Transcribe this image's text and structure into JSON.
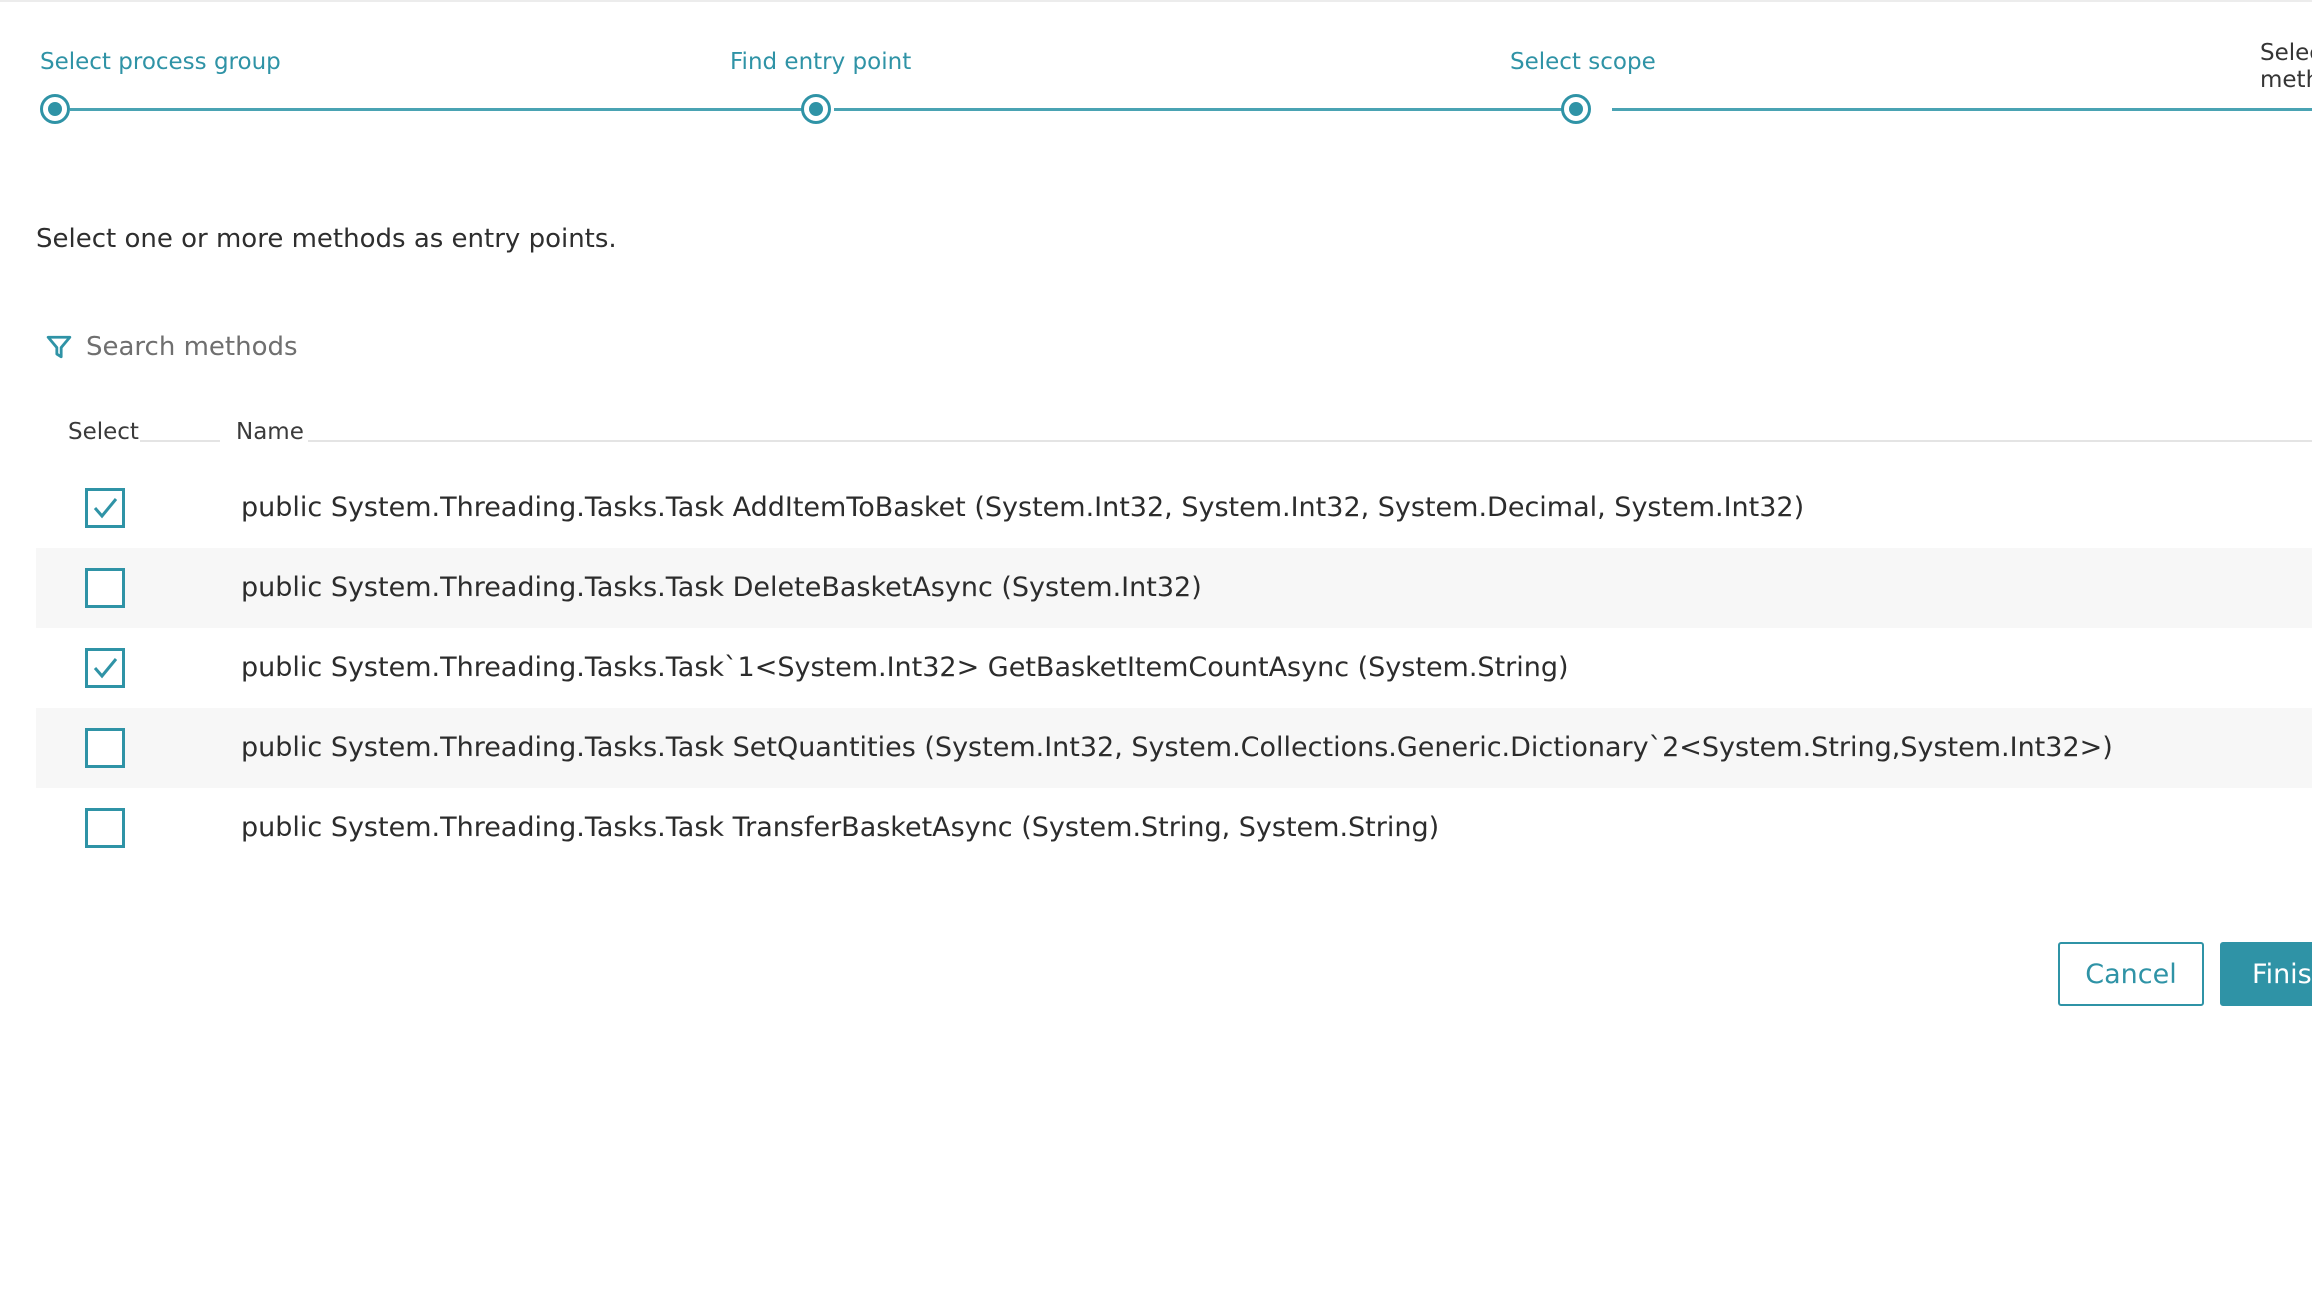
{
  "stepper": {
    "steps": [
      {
        "label": "Select process group"
      },
      {
        "label": "Find entry point"
      },
      {
        "label": "Select scope"
      },
      {
        "label_line1": "Selec",
        "label_line2": "meth"
      }
    ]
  },
  "intro": "Select one or more methods as entry points.",
  "search": {
    "placeholder": "Search methods",
    "value": ""
  },
  "table": {
    "headers": {
      "select": "Select",
      "name": "Name"
    },
    "rows": [
      {
        "checked": true,
        "name": "public System.Threading.Tasks.Task AddItemToBasket (System.Int32, System.Int32, System.Decimal, System.Int32)"
      },
      {
        "checked": false,
        "name": "public System.Threading.Tasks.Task DeleteBasketAsync (System.Int32)"
      },
      {
        "checked": true,
        "name": "public System.Threading.Tasks.Task`1<System.Int32> GetBasketItemCountAsync (System.String)"
      },
      {
        "checked": false,
        "name": "public System.Threading.Tasks.Task SetQuantities (System.Int32, System.Collections.Generic.Dictionary`2<System.String,System.Int32>)"
      },
      {
        "checked": false,
        "name": "public System.Threading.Tasks.Task TransferBasketAsync (System.String, System.String)"
      }
    ]
  },
  "buttons": {
    "cancel": "Cancel",
    "finish": "Finish"
  },
  "colors": {
    "accent": "#2f93a6",
    "text": "#353535",
    "row_alt": "#f7f7f7"
  },
  "icons": {
    "search": "filter-icon",
    "checkbox_checked": "checkmark-icon"
  }
}
